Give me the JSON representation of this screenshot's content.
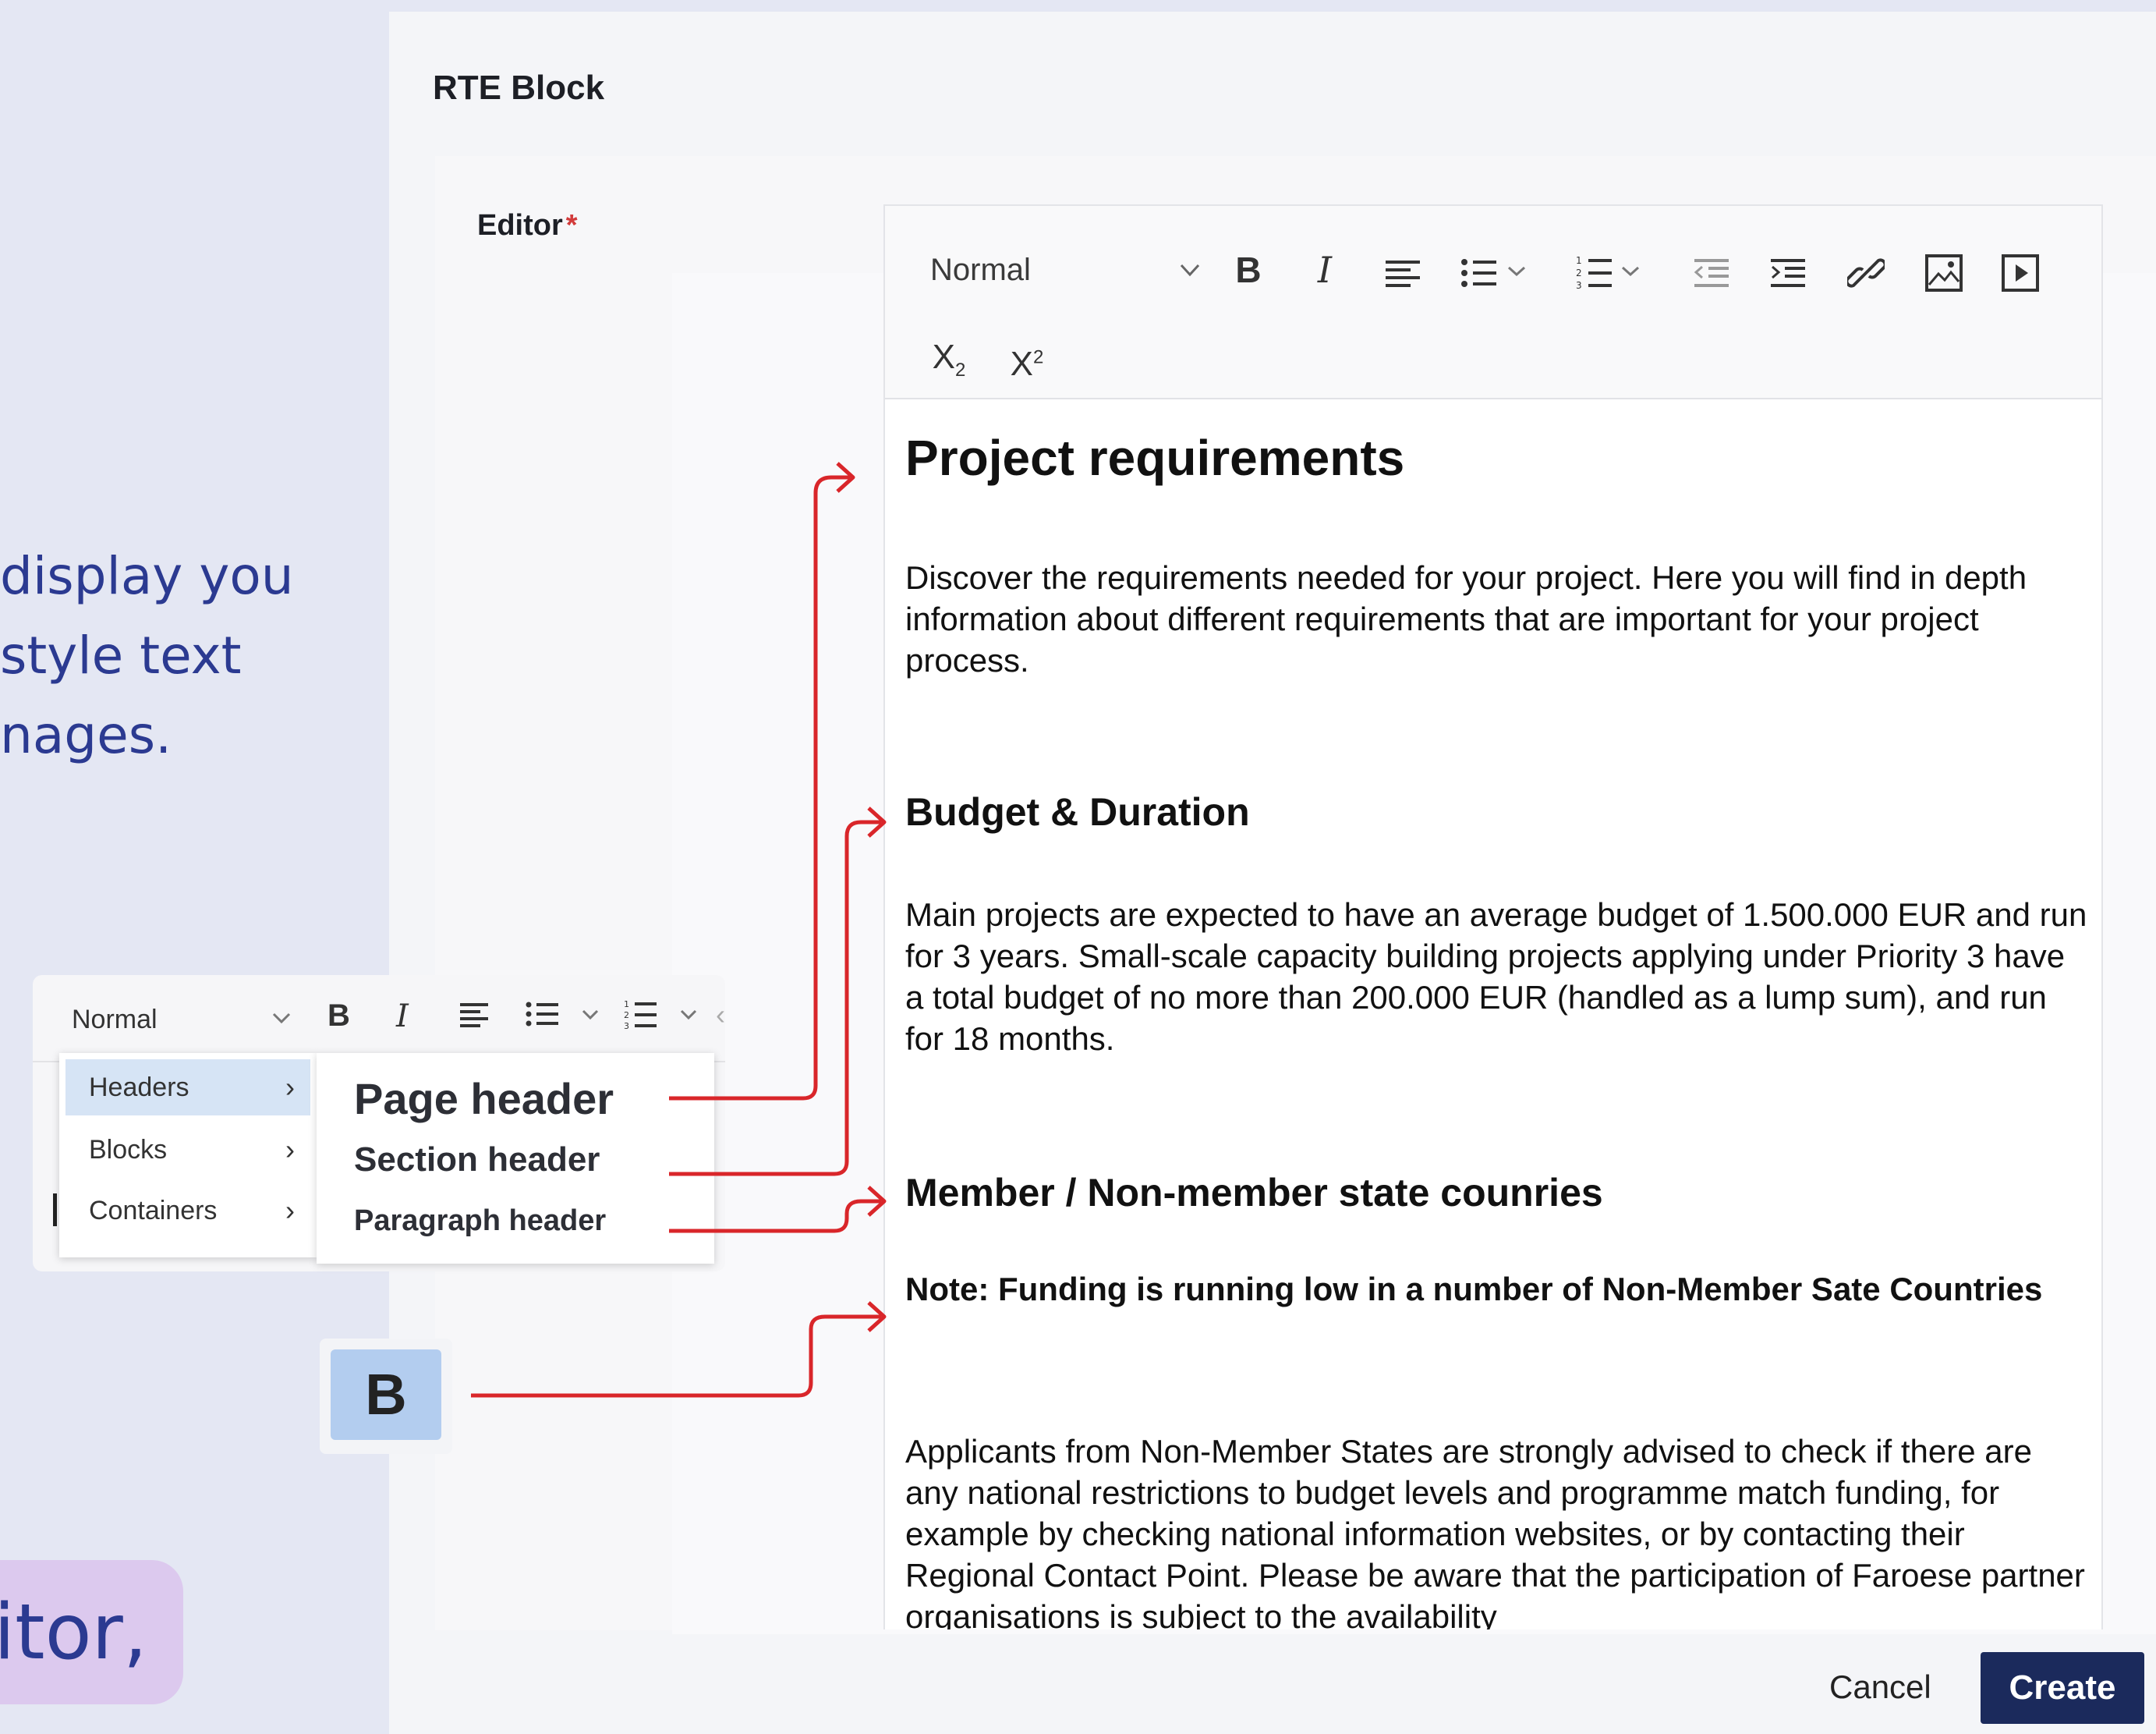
{
  "intro_text_lines": [
    "display you",
    "style text",
    "nages."
  ],
  "pill_text": "itor,",
  "panel": {
    "title": "RTE Block",
    "field_label": "Editor",
    "required_mark": "*"
  },
  "toolbar": {
    "style_select": "Normal",
    "buttons": [
      "bold",
      "italic",
      "align-left",
      "bullet-list",
      "numbered-list",
      "outdent",
      "indent",
      "link",
      "image",
      "video",
      "subscript",
      "superscript"
    ]
  },
  "content": {
    "title": "Project requirements",
    "intro": "Discover the requirements needed for your project. Here you will find in depth information about different requirements that are important for your project process.",
    "section1_title": "Budget & Duration",
    "section1_body": "Main projects are expected to have an average budget of 1.500.000 EUR and run for 3 years. Small-scale capacity building projects applying under Priority 3 have a total budget of no more than 200.000 EUR (handled as a lump sum), and run for 18 months.",
    "section2_title": "Member / Non-member state counries",
    "section2_note": "Note: Funding is running low in a number of Non-Member Sate Countries",
    "section2_body": "Applicants from Non-Member States are strongly advised to check if there are any national restrictions to budget levels and programme match funding, for example by checking national information websites, or by contacting their Regional Contact Point. Please be aware that the participation of Faroese partner organisations is subject to the availability"
  },
  "footer": {
    "cancel": "Cancel",
    "create": "Create"
  },
  "dropdown_demo": {
    "style_select": "Normal",
    "menu": [
      {
        "label": "Headers",
        "active": true
      },
      {
        "label": "Blocks",
        "active": false
      },
      {
        "label": "Containers",
        "active": false
      }
    ],
    "submenu": [
      "Page header",
      "Section header",
      "Paragraph header"
    ],
    "bold_label": "B"
  },
  "colors": {
    "accent": "#2b3a91",
    "arrow": "#d9262a",
    "create_button": "#1b2a5c",
    "highlight": "#d6e4f5",
    "pill": "#dcc9ee"
  }
}
